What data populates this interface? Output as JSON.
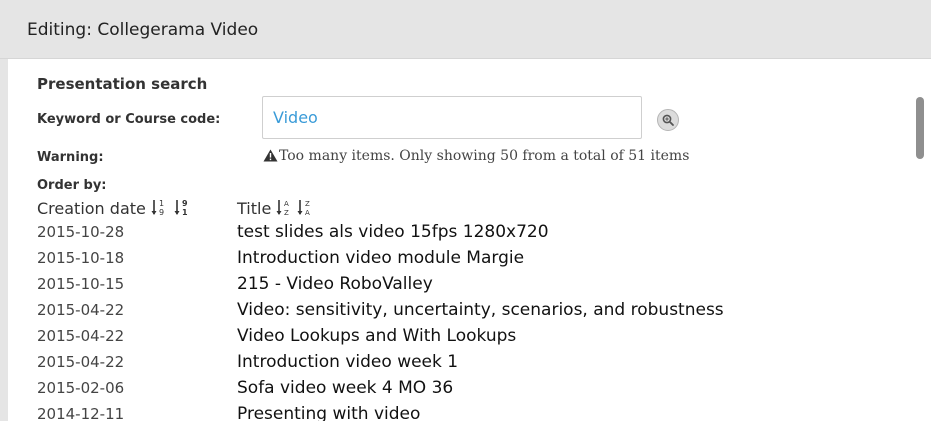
{
  "window": {
    "title": "Editing: Collegerama Video"
  },
  "search": {
    "section_title": "Presentation search",
    "keyword_label": "Keyword or Course code:",
    "keyword_value": "Video",
    "search_icon": "magnifier-icon",
    "warning_label": "Warning:",
    "warning_text": "Too many items. Only showing 50 from a total of 51 items",
    "warning_icon": "warning-triangle-icon",
    "order_label": "Order by:"
  },
  "columns": {
    "creation_date": "Creation date",
    "title": "Title"
  },
  "results": [
    {
      "date": "2015-10-28",
      "title": "test slides als video 15fps 1280x720"
    },
    {
      "date": "2015-10-18",
      "title": "Introduction video module Margie"
    },
    {
      "date": "2015-10-15",
      "title": "215 - Video RoboValley"
    },
    {
      "date": "2015-04-22",
      "title": "Video: sensitivity, uncertainty, scenarios, and robustness"
    },
    {
      "date": "2015-04-22",
      "title": "Video Lookups and With Lookups"
    },
    {
      "date": "2015-04-22",
      "title": "Introduction video week 1"
    },
    {
      "date": "2015-02-06",
      "title": "Sofa video week 4 MO 36"
    },
    {
      "date": "2014-12-11",
      "title": "Presenting  with  video"
    }
  ]
}
